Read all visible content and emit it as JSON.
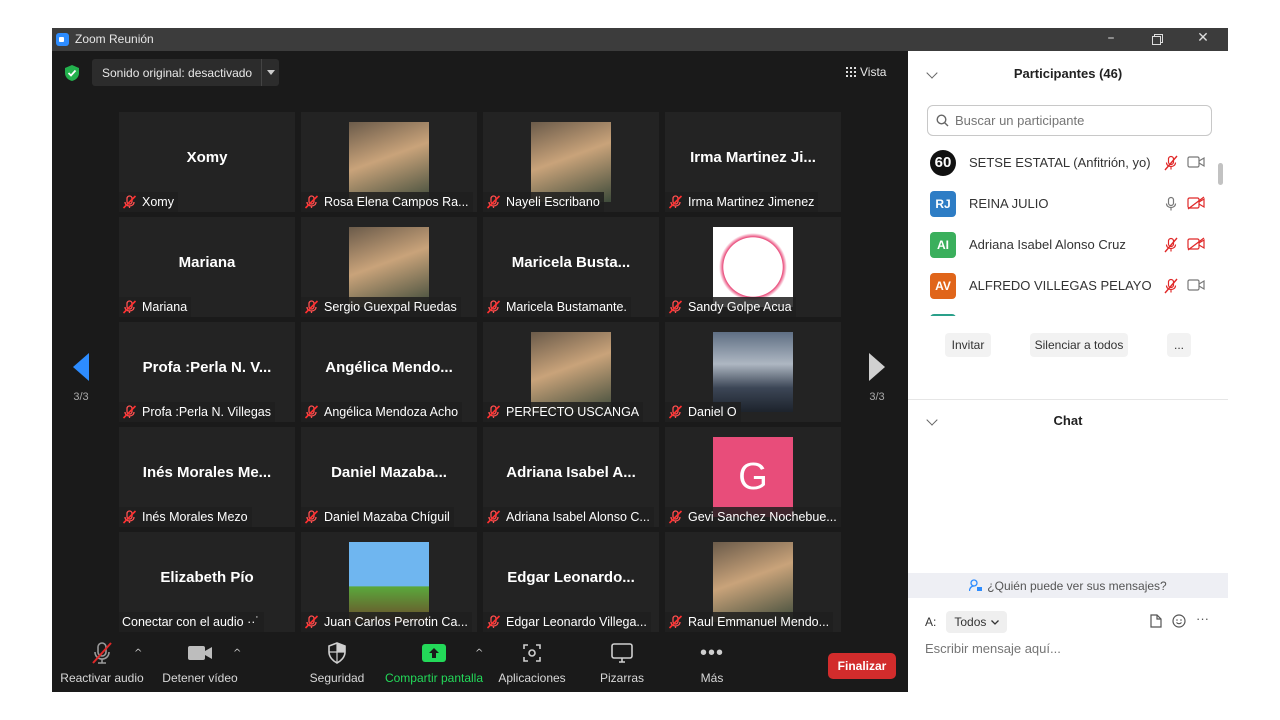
{
  "window": {
    "title": "Zoom Reunión",
    "controls": [
      "minimize",
      "restore",
      "close"
    ]
  },
  "video": {
    "sound_option": "Sonido original: desactivado",
    "view_button": "Vista",
    "page_left": "3/3",
    "page_right": "3/3",
    "tiles": [
      {
        "big": "Xomy",
        "label": "Xomy",
        "muted": true
      },
      {
        "photo": "person-photo",
        "label": "Rosa Elena Campos Ra...",
        "muted": true
      },
      {
        "photo": "person-photo",
        "label": "Nayeli Escribano",
        "muted": true
      },
      {
        "big": "Irma  Martinez  Ji...",
        "label": "Irma Martinez Jimenez",
        "muted": true
      },
      {
        "big": "Mariana",
        "label": "Mariana",
        "muted": true
      },
      {
        "photo": "person-photo",
        "label": "Sergio Guexpal Ruedas",
        "muted": true
      },
      {
        "big": "Maricela  Busta...",
        "label": "Maricela Bustamante.",
        "muted": true
      },
      {
        "photo": "febrero-6A-image",
        "label": "Sandy Golpe Acua",
        "muted": true
      },
      {
        "big": "Profa :Perla N. V...",
        "label": "Profa :Perla N. Villegas",
        "muted": true
      },
      {
        "big": "Angélica  Mendo...",
        "label": "Angélica Mendoza Acho",
        "muted": true
      },
      {
        "photo": "person-photo",
        "label": "PERFECTO USCANGA",
        "muted": true
      },
      {
        "photo": "sky-photo",
        "label": "Daniel O",
        "muted": true
      },
      {
        "big": "Inés  Morales  Me...",
        "label": "Inés Morales Mezo",
        "muted": true
      },
      {
        "big": "Daniel  Mazaba...",
        "label": "Daniel Mazaba Chíguil",
        "muted": true
      },
      {
        "big": "Adriana  Isabel  A...",
        "label": "Adriana Isabel Alonso C...",
        "muted": true
      },
      {
        "letter": "G",
        "label": "Gevi Sanchez Nochebue...",
        "muted": true
      },
      {
        "big": "Elizabeth  Pío",
        "label": "Conectar con el audio ··˙",
        "muted": false
      },
      {
        "photo": "minecraft-image",
        "label": "Juan Carlos Perrotin Ca...",
        "muted": true
      },
      {
        "big": "Edgar  Leonardo...",
        "label": "Edgar Leonardo Villega...",
        "muted": true
      },
      {
        "photo": "person-photo",
        "label": "Raul Emmanuel Mendo...",
        "muted": true
      }
    ]
  },
  "toolbar": {
    "unmute": "Reactivar audio",
    "stop_video": "Detener vídeo",
    "security": "Seguridad",
    "share": "Compartir pantalla",
    "apps": "Aplicaciones",
    "whiteboards": "Pizarras",
    "more": "Más",
    "end": "Finalizar"
  },
  "participants": {
    "title": "Participantes (46)",
    "search_placeholder": "Buscar un participante",
    "list": [
      {
        "avatar": "60",
        "name": "SETSE ESTATAL (Anfitrión, yo)",
        "color": "#111111"
      },
      {
        "avatar": "RJ",
        "name": "REINA JULIO",
        "color": "#2e7dc5"
      },
      {
        "avatar": "AI",
        "name": "Adriana Isabel Alonso Cruz",
        "color": "#3aaf5c"
      },
      {
        "avatar": "AV",
        "name": "ALFREDO VILLEGAS PELAYO",
        "color": "#e0651a"
      }
    ],
    "invite": "Invitar",
    "mute_all": "Silenciar a todos",
    "more": "..."
  },
  "chat": {
    "title": "Chat",
    "who_can_see": "¿Quién puede ver sus mensajes?",
    "to_label": "A:",
    "to_value": "Todos",
    "placeholder": "Escribir mensaje aquí..."
  },
  "colors": {
    "accent_blue": "#2d8cff",
    "share_green": "#23d959",
    "end_red": "#d22c2c",
    "mute_red": "#e02828"
  }
}
